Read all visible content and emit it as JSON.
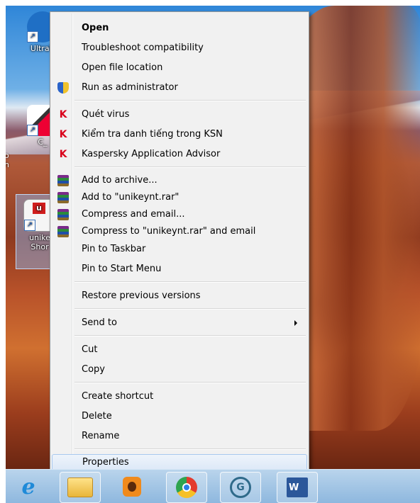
{
  "desktop": {
    "icons": [
      {
        "label": "UltraV",
        "name": "ultraviewer"
      },
      {
        "label": "C_",
        "name": "c-shortcut"
      },
      {
        "label": "unike",
        "label2": "Shor",
        "name": "unikey-shortcut"
      }
    ],
    "edge_fragments": [
      "o",
      "h"
    ]
  },
  "menu": {
    "items": [
      {
        "label": "Open",
        "icon": "none",
        "bold": true
      },
      {
        "label": "Troubleshoot compatibility",
        "icon": "none"
      },
      {
        "label": "Open file location",
        "icon": "none"
      },
      {
        "label": "Run as administrator",
        "icon": "uac-shield-icon"
      },
      {
        "label": "Quét virus",
        "icon": "kaspersky-icon"
      },
      {
        "label": "Kiểm tra danh tiếng trong KSN",
        "icon": "kaspersky-icon"
      },
      {
        "label": "Kaspersky Application Advisor",
        "icon": "kaspersky-icon"
      },
      {
        "label": "Add to archive...",
        "icon": "winrar-icon"
      },
      {
        "label": "Add to \"unikeynt.rar\"",
        "icon": "winrar-icon"
      },
      {
        "label": "Compress and email...",
        "icon": "winrar-icon"
      },
      {
        "label": "Compress to \"unikeynt.rar\" and email",
        "icon": "winrar-icon"
      },
      {
        "label": "Pin to Taskbar",
        "icon": "none"
      },
      {
        "label": "Pin to Start Menu",
        "icon": "none"
      },
      {
        "label": "Restore previous versions",
        "icon": "none"
      },
      {
        "label": "Send to",
        "icon": "none",
        "submenu": true
      },
      {
        "label": "Cut",
        "icon": "none"
      },
      {
        "label": "Copy",
        "icon": "none"
      },
      {
        "label": "Create shortcut",
        "icon": "none"
      },
      {
        "label": "Delete",
        "icon": "none"
      },
      {
        "label": "Rename",
        "icon": "none"
      },
      {
        "label": "Properties",
        "icon": "none",
        "highlighted": true
      }
    ]
  },
  "taskbar": {
    "buttons": [
      {
        "name": "internet-explorer-icon",
        "glyph": "e"
      },
      {
        "name": "file-explorer-icon"
      },
      {
        "name": "media-player-icon"
      },
      {
        "name": "chrome-icon"
      },
      {
        "name": "speed-gauge-icon",
        "glyph": "G"
      },
      {
        "name": "word-icon",
        "glyph": "W"
      }
    ]
  }
}
